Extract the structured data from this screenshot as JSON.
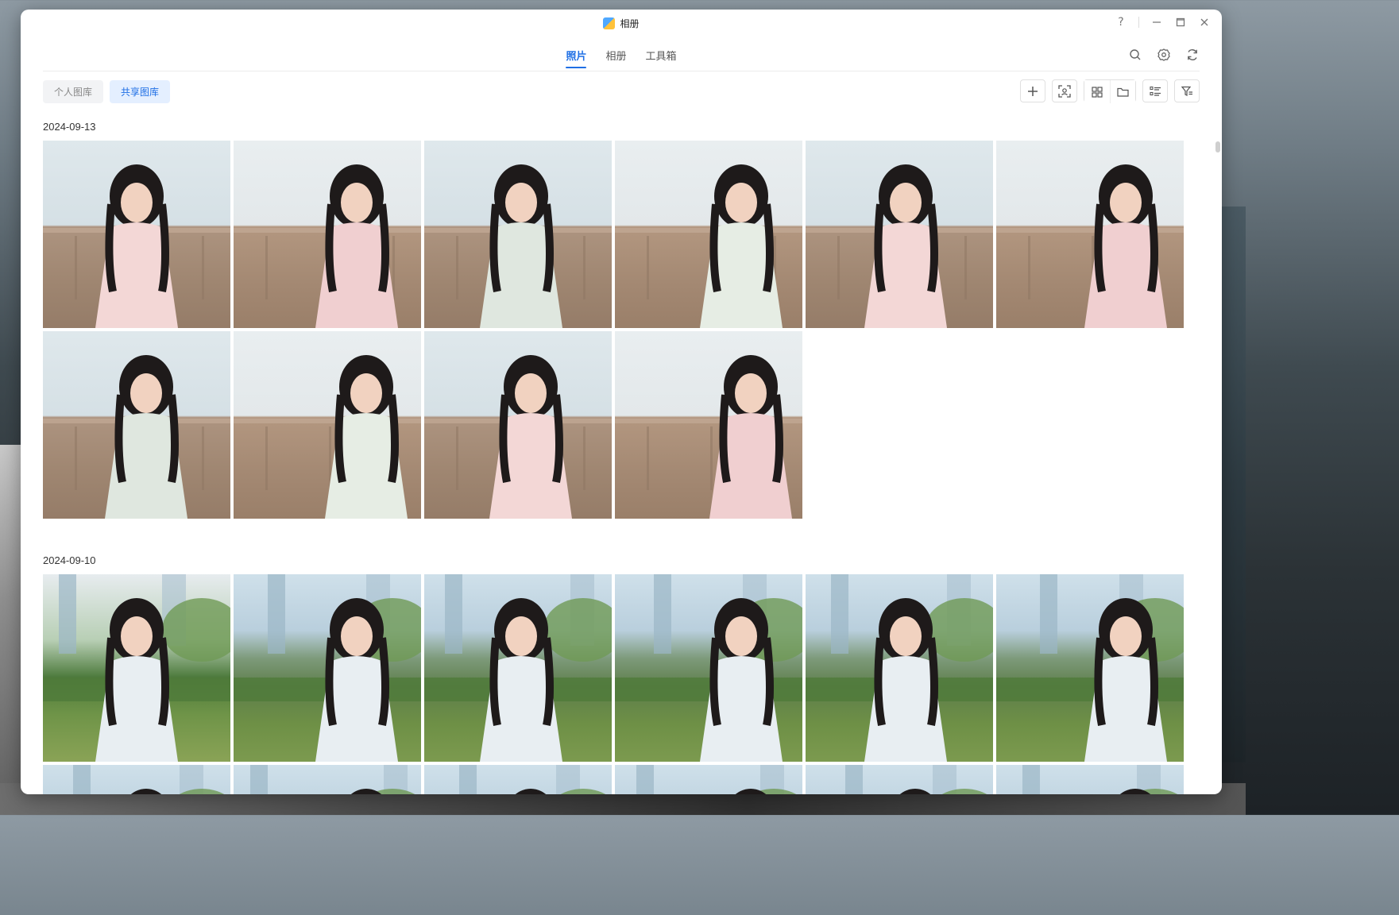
{
  "window": {
    "title": "相册",
    "controls": {
      "help": "?",
      "minimize": "—",
      "maximize": "☐",
      "close": "✕"
    }
  },
  "tabs": [
    {
      "label": "照片",
      "active": true
    },
    {
      "label": "相册",
      "active": false
    },
    {
      "label": "工具箱",
      "active": false
    }
  ],
  "library": {
    "personal_label": "个人图库",
    "shared_label": "共享图库",
    "selected": "共享图库"
  },
  "groups": [
    {
      "date": "2024-09-13",
      "photo_count": 10,
      "scene": "indoor"
    },
    {
      "date": "2024-09-10",
      "photo_count": 12,
      "scene": "outdoor"
    }
  ],
  "theme": {
    "accent": "#1f6fe5",
    "accent_bg": "#e4efff"
  }
}
